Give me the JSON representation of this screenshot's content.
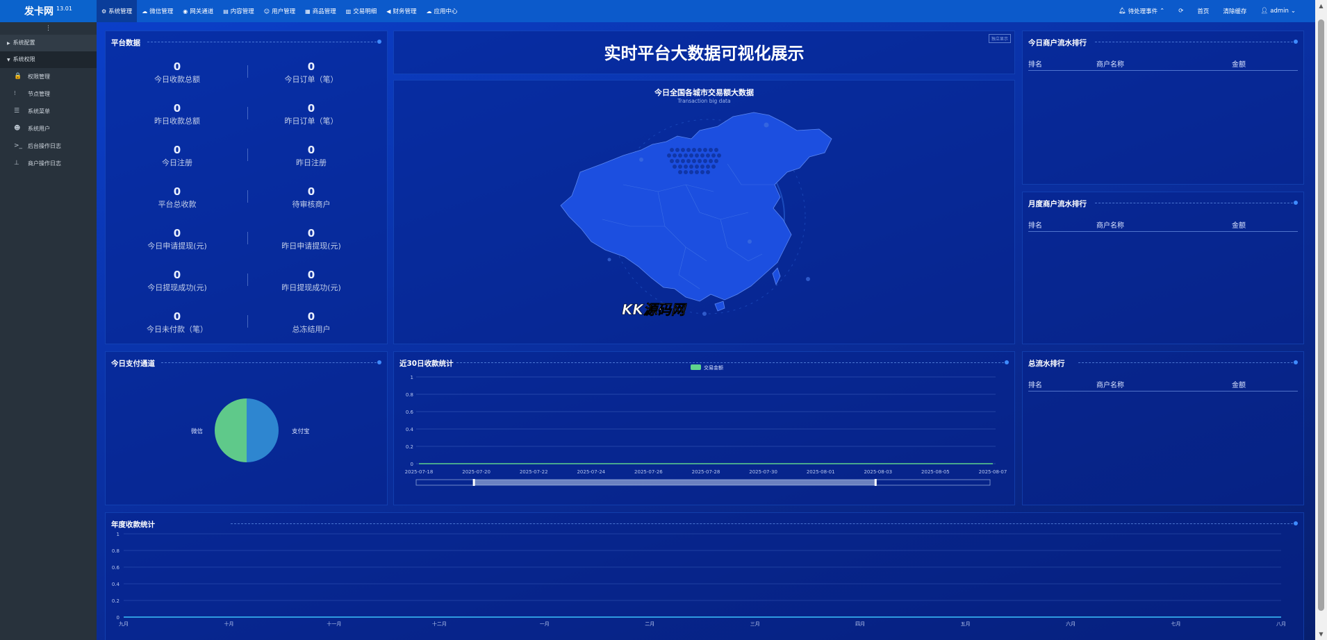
{
  "app": {
    "brand": "发卡网",
    "version": "13.01"
  },
  "topnav": [
    {
      "icon": "⚙",
      "icon_name": "gear-icon",
      "label": "系统管理",
      "active": true
    },
    {
      "icon": "☁",
      "icon_name": "wechat-icon",
      "label": "微信管理"
    },
    {
      "icon": "◉",
      "icon_name": "gateway-icon",
      "label": "网关通道"
    },
    {
      "icon": "▤",
      "icon_name": "file-icon",
      "label": "内容管理"
    },
    {
      "icon": "☺",
      "icon_name": "users-icon",
      "label": "用户管理"
    },
    {
      "icon": "▦",
      "icon_name": "shop-icon",
      "label": "商品管理"
    },
    {
      "icon": "▥",
      "icon_name": "bar-chart-icon",
      "label": "交易明细"
    },
    {
      "icon": "◀",
      "icon_name": "bullhorn-icon",
      "label": "财务管理"
    },
    {
      "icon": "☁",
      "icon_name": "cloud-icon",
      "label": "应用中心"
    }
  ],
  "topright": {
    "pending": "待处理事件",
    "refresh_icon": "⟳",
    "home": "首页",
    "clear_cache": "清除缓存",
    "user": "admin"
  },
  "sidebar": {
    "toggle": "⋮",
    "groups": [
      {
        "label": "系统配置",
        "open": false
      },
      {
        "label": "系统权限",
        "open": true
      }
    ],
    "items": [
      {
        "icon": "🔒",
        "icon_name": "lock-icon",
        "label": "权限管理"
      },
      {
        "icon": "⁝",
        "icon_name": "ellipsis-icon",
        "label": "节点管理"
      },
      {
        "icon": "☰",
        "icon_name": "menu-icon",
        "label": "系统菜单"
      },
      {
        "icon": "☻",
        "icon_name": "users-icon",
        "label": "系统用户"
      },
      {
        "icon": ">_",
        "icon_name": "terminal-icon",
        "label": "后台操作日志"
      },
      {
        "icon": "⊥",
        "icon_name": "pin-icon",
        "label": "商户操作日志"
      }
    ]
  },
  "platform": {
    "title": "平台数据",
    "stats": [
      {
        "value": "0",
        "label": "今日收款总额"
      },
      {
        "value": "0",
        "label": "今日订单（笔）"
      },
      {
        "value": "0",
        "label": "昨日收款总额"
      },
      {
        "value": "0",
        "label": "昨日订单（笔）"
      },
      {
        "value": "0",
        "label": "今日注册"
      },
      {
        "value": "0",
        "label": "昨日注册"
      },
      {
        "value": "0",
        "label": "平台总收款"
      },
      {
        "value": "0",
        "label": "待审核商户"
      },
      {
        "value": "0",
        "label": "今日申请提现(元)"
      },
      {
        "value": "0",
        "label": "昨日申请提现(元)"
      },
      {
        "value": "0",
        "label": "今日提现成功(元)"
      },
      {
        "value": "0",
        "label": "昨日提现成功(元)"
      },
      {
        "value": "0",
        "label": "今日未付款（笔）"
      },
      {
        "value": "0",
        "label": "总冻结用户"
      }
    ]
  },
  "header_panel": {
    "title": "实时平台大数据可视化展示",
    "subtitle": "",
    "fullscreen": "独立显示"
  },
  "map_panel": {
    "title": "今日全国各城市交易额大数据",
    "subtitle": "Transaction big data",
    "watermark": "KK源码网"
  },
  "rank_today": {
    "title": "今日商户流水排行",
    "cols": [
      "排名",
      "商户名称",
      "金额"
    ]
  },
  "rank_month": {
    "title": "月度商户流水排行",
    "cols": [
      "排名",
      "商户名称",
      "金额"
    ]
  },
  "rank_total": {
    "title": "总流水排行",
    "cols": [
      "排名",
      "商户名称",
      "金额"
    ]
  },
  "pay_channel": {
    "title": "今日支付通道",
    "chart_data": {
      "type": "pie",
      "labels": [
        "微信",
        "支付宝"
      ],
      "values": [
        1,
        1
      ],
      "colors": [
        "#5fc98a",
        "#2e86d0"
      ]
    }
  },
  "recent30": {
    "title": "近30日收款统计",
    "chart_data": {
      "type": "line",
      "series": [
        {
          "name": "交易金额",
          "color": "#5fd38d",
          "values": [
            0,
            0,
            0,
            0,
            0,
            0,
            0,
            0,
            0,
            0,
            0,
            0,
            0,
            0,
            0,
            0,
            0,
            0,
            0,
            0,
            0
          ]
        }
      ],
      "x": [
        "2025-07-18",
        "2025-07-19",
        "2025-07-20",
        "2025-07-21",
        "2025-07-22",
        "2025-07-23",
        "2025-07-24",
        "2025-07-25",
        "2025-07-26",
        "2025-07-27",
        "2025-07-28",
        "2025-07-29",
        "2025-07-30",
        "2025-07-31",
        "2025-08-01",
        "2025-08-02",
        "2025-08-03",
        "2025-08-04",
        "2025-08-05",
        "2025-08-06",
        "2025-08-07"
      ],
      "x_tick_labels": [
        "2025-07-18",
        "2025-07-20",
        "2025-07-22",
        "2025-07-24",
        "2025-07-26",
        "2025-07-28",
        "2025-07-30",
        "2025-08-01",
        "2025-08-03",
        "2025-08-05",
        "2025-08-07"
      ],
      "y_ticks": [
        "0",
        "0.2",
        "0.4",
        "0.6",
        "0.8",
        "1"
      ],
      "ylim": [
        0,
        1
      ],
      "legend": "top-center",
      "zoom_range": [
        0.1,
        0.8
      ]
    }
  },
  "yearly": {
    "title": "年度收款统计",
    "chart_data": {
      "type": "line",
      "series": [
        {
          "color": "#2f9be0",
          "values": [
            0,
            0,
            0,
            0,
            0,
            0,
            0,
            0,
            0,
            0,
            0,
            0
          ]
        }
      ],
      "x": [
        "九月",
        "十月",
        "十一月",
        "十二月",
        "一月",
        "二月",
        "三月",
        "四月",
        "五月",
        "六月",
        "七月",
        "八月"
      ],
      "y_ticks": [
        "0",
        "0.2",
        "0.4",
        "0.6",
        "0.8",
        "1"
      ],
      "ylim": [
        0,
        1
      ]
    }
  }
}
